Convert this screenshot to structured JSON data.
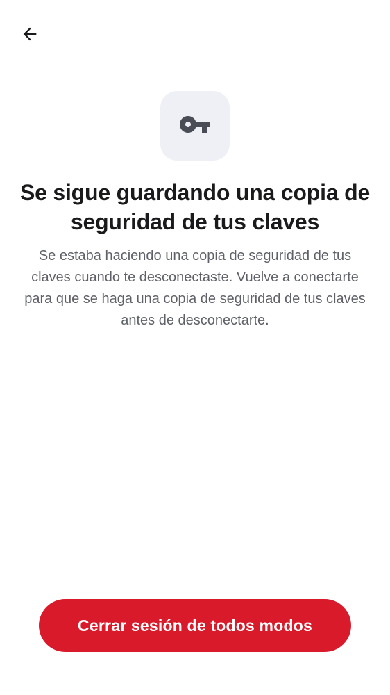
{
  "header": {
    "back_icon": "arrow-left-icon"
  },
  "hero": {
    "icon": "key-icon",
    "tile_color": "#eef0f5",
    "icon_color": "#4a4d55"
  },
  "content": {
    "title": "Se sigue guardando una copia de seguridad de tus claves",
    "body": "Se estaba haciendo una copia de seguridad de tus claves cuando te desconectaste. Vuelve a conectarte para que se haga una copia de seguridad de tus claves antes de desconectarte."
  },
  "actions": {
    "logout_anyway_label": "Cerrar sesión de todos modos",
    "accent_color": "#d81a2b"
  }
}
